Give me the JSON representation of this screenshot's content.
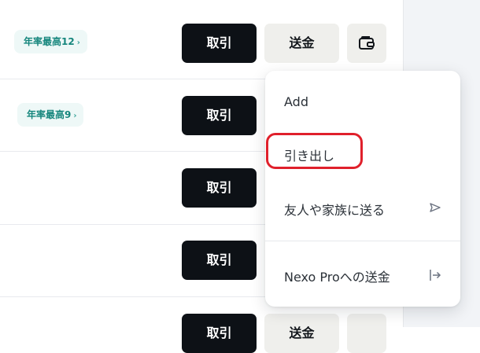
{
  "rows": [
    {
      "badge": "年率最高12",
      "badge_chevron": "›",
      "trade_label": "取引",
      "send_label": "送金",
      "wallet_icon": "wallet-icon"
    },
    {
      "badge": "年率最高9",
      "badge_chevron": "›",
      "trade_label": "取引"
    },
    {
      "trade_label": "取引"
    },
    {
      "trade_label": "取引"
    },
    {
      "trade_label": "取引",
      "send_label": "送金"
    }
  ],
  "menu": {
    "items": [
      {
        "label": "Add"
      },
      {
        "label": "引き出し",
        "highlighted": true
      },
      {
        "label": "友人や家族に送る",
        "icon": "send-arrow-icon"
      },
      {
        "label": "Nexo Proへの送金",
        "icon": "transfer-out-icon"
      }
    ]
  },
  "colors": {
    "trade_button": "#0d1116",
    "send_button": "#efefec",
    "badge_bg": "#eef8f7",
    "badge_text": "#16867d",
    "highlight": "#e0202b"
  }
}
